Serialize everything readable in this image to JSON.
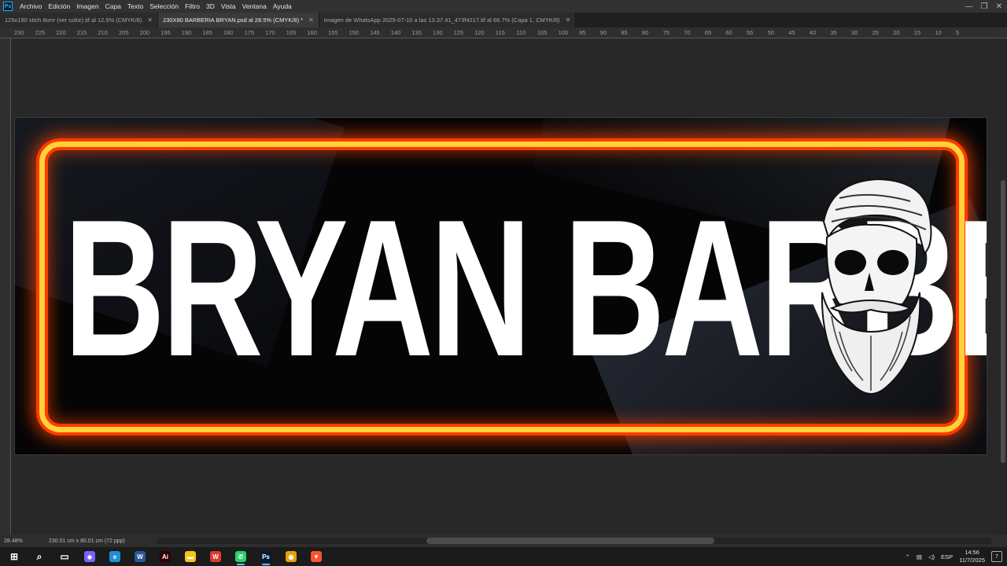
{
  "app": {
    "logo": "Ps"
  },
  "menubar": {
    "items": [
      "Archivo",
      "Edición",
      "Imagen",
      "Capa",
      "Texto",
      "Selección",
      "Filtro",
      "3D",
      "Vista",
      "Ventana",
      "Ayuda"
    ]
  },
  "window_controls": {
    "minimize": "—",
    "restore": "❐",
    "close": "✕"
  },
  "tabs": [
    {
      "label": "125x190 stich 8orrr (ver color).tif al 12.5% (CMYK/8)",
      "active": false
    },
    {
      "label": "230X80 BARBERIA BRYAN.psd al 28.5% (CMYK/8) *",
      "active": true
    },
    {
      "label": "Imagen de WhatsApp 2025-07-10 a las 13.37.41_473f4217.tif al 66.7% (Capa 1, CMYK/8)",
      "active": false
    }
  ],
  "ruler_top": {
    "labels": [
      "230",
      "225",
      "220",
      "215",
      "210",
      "205",
      "200",
      "195",
      "190",
      "185",
      "180",
      "175",
      "170",
      "165",
      "160",
      "155",
      "150",
      "145",
      "140",
      "135",
      "130",
      "125",
      "120",
      "115",
      "110",
      "105",
      "100",
      "95",
      "90",
      "85",
      "80",
      "75",
      "70",
      "65",
      "60",
      "55",
      "50",
      "45",
      "40",
      "35",
      "30",
      "25",
      "20",
      "15",
      "10",
      "5"
    ]
  },
  "canvas": {
    "banner_text": "BRYAN BARBER",
    "frame_color_outer": "#ff3b00",
    "frame_color_inner": "#ffd23a"
  },
  "statusbar": {
    "zoom": "28.48%",
    "doc_size": "230.01 cm x 80.01 cm (72 ppp)"
  },
  "taskbar": {
    "icons": [
      {
        "name": "windows-start-icon",
        "glyph": "⊞",
        "color": "#ffffff"
      },
      {
        "name": "search-icon",
        "glyph": "⌕",
        "color": "#ffffff"
      },
      {
        "name": "task-view-icon",
        "glyph": "▭",
        "color": "#ffffff"
      },
      {
        "name": "copilot-icon",
        "glyph": "◆",
        "color": "#7b61ff"
      },
      {
        "name": "edge-icon",
        "glyph": "e",
        "color": "#1e90d6"
      },
      {
        "name": "word-icon",
        "glyph": "W",
        "color": "#2b579a"
      },
      {
        "name": "illustrator-icon",
        "glyph": "Ai",
        "color": "#330000"
      },
      {
        "name": "file-explorer-icon",
        "glyph": "▬",
        "color": "#f5c518"
      },
      {
        "name": "wps-icon",
        "glyph": "W",
        "color": "#e03a2f"
      },
      {
        "name": "whatsapp-icon",
        "glyph": "✆",
        "color": "#25d366"
      },
      {
        "name": "photoshop-icon",
        "glyph": "Ps",
        "color": "#001d34"
      },
      {
        "name": "chrome-icon",
        "glyph": "◉",
        "color": "#e8a100"
      },
      {
        "name": "brave-icon",
        "glyph": "▼",
        "color": "#fb542b"
      }
    ]
  },
  "tray": {
    "language": "ESP",
    "time": "14:56",
    "date": "11/7/2025",
    "notifications": "7"
  }
}
